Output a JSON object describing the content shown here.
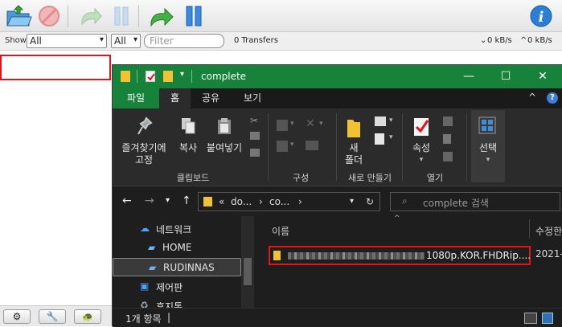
{
  "transmission": {
    "filter": {
      "show_label": "Show",
      "status_value": "All",
      "tracker_value": "All",
      "search_placeholder": "Filter",
      "transfers": "0 Transfers",
      "down_speed": "0 kB/s",
      "up_speed": "0 kB/s"
    }
  },
  "explorer": {
    "title": "complete",
    "tabs": [
      "파일",
      "홈",
      "공유",
      "보기"
    ],
    "ribbon": {
      "pin_label_1": "즐겨찾기에",
      "pin_label_2": "고정",
      "copy": "복사",
      "paste": "붙여넣기",
      "clipboard_group": "클립보드",
      "organize_group": "구성",
      "new_folder_1": "새",
      "new_folder_2": "폴더",
      "new_group": "새로 만들기",
      "properties": "속성",
      "open_group": "열기",
      "select": "선택"
    },
    "address": {
      "ellipsis": "«",
      "seg1": "do...",
      "seg2": "co...",
      "search_placeholder": "complete 검색"
    },
    "nav": {
      "network": "네트워크",
      "home": "HOME",
      "rudinnas": "RUDINNAS",
      "control_panel": "제어판",
      "recycle": "휴지통"
    },
    "columns": {
      "name": "이름",
      "modified": "수정한"
    },
    "file": {
      "name_suffix": "1080p.KOR.FHDRip....",
      "date": "2021-"
    },
    "status": "1개 항목"
  }
}
